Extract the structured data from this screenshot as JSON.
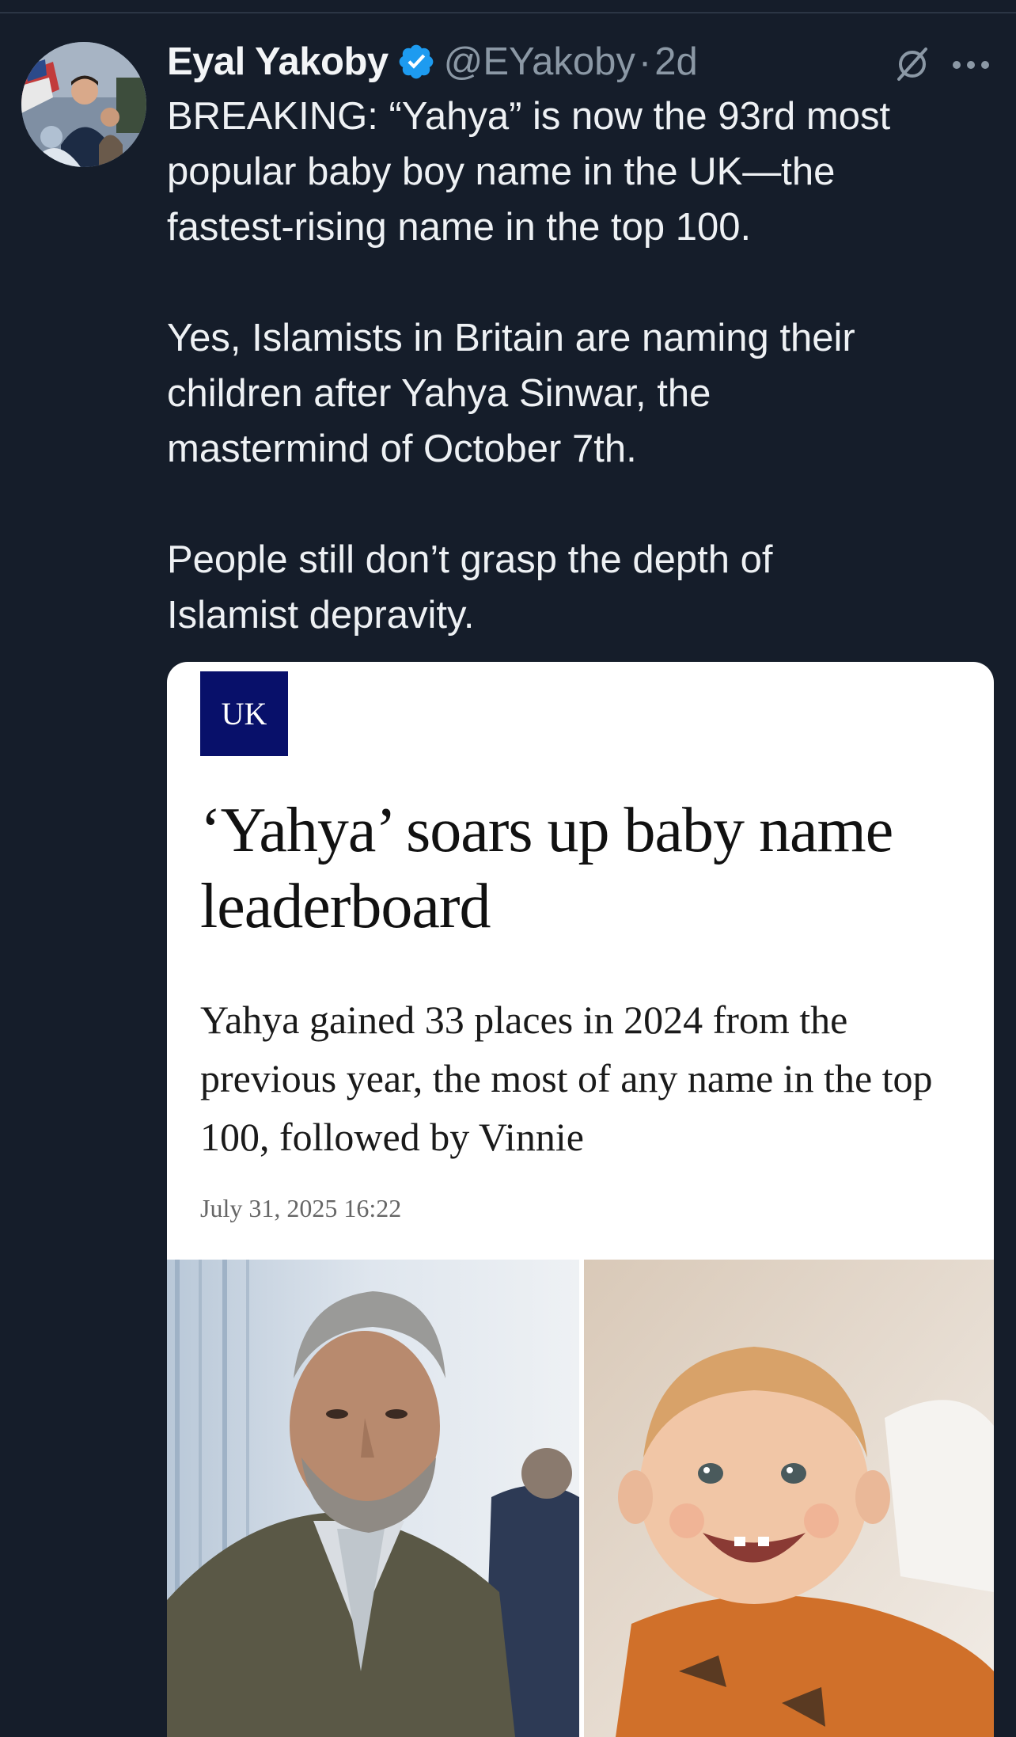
{
  "tweet": {
    "author_name": "Eyal Yakoby",
    "handle": "@EYakoby",
    "separator": "·",
    "time_ago": "2d",
    "paragraphs": [
      "BREAKING: “Yahya” is now the 93rd most\npopular baby boy name in the UK—the\nfastest-rising name in the top 100.",
      "Yes, Islamists in Britain are naming their\nchildren after Yahya Sinwar, the\nmastermind of October 7th.",
      "People still don’t grasp the depth of\nIslamist depravity."
    ],
    "icons": {
      "verified": "verified-badge-icon",
      "grok": "grok-icon",
      "more": "more-options-icon"
    }
  },
  "article_card": {
    "section_label": "UK",
    "headline": "‘Yahya’ soars up baby name leaderboard",
    "standfirst": "Yahya gained 33 places in 2024 from the previous year, the most of any name in the top 100, followed by Vinnie",
    "date": "July 31, 2025 16:22"
  },
  "colors": {
    "background": "#151d2a",
    "text_primary": "#eef1f4",
    "text_secondary": "#8b98a5",
    "verified_blue": "#1d9bf0",
    "badge_navy": "#08106a"
  }
}
